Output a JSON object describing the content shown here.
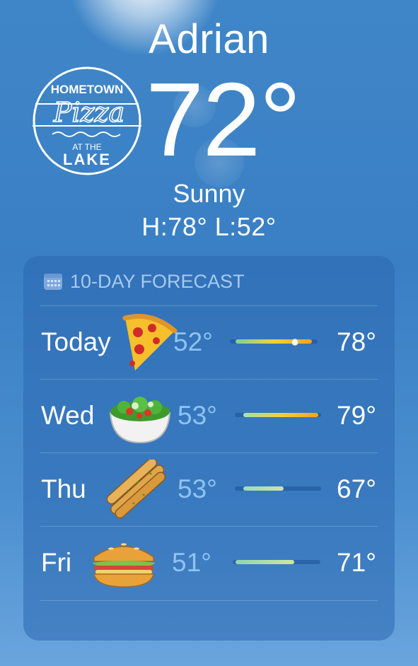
{
  "location": {
    "city": "Adrian",
    "temperature": "72°",
    "condition": "Sunny",
    "high_low": "H:78°  L:52°"
  },
  "logo": {
    "line1": "HOMETOWN",
    "line2": "Pizza",
    "line3": "AT THE",
    "line4": "LAKE"
  },
  "forecast": {
    "header": "10-DAY FORECAST",
    "range_min": 50,
    "range_max": 80,
    "days": [
      {
        "day": "Today",
        "icon": "pizza-slice-icon",
        "low": "52°",
        "high": "78°",
        "low_value": 52,
        "high_value": 78,
        "current_value": 72,
        "colors": [
          "#7ed0a0",
          "#f0d23a",
          "#f7a21b"
        ]
      },
      {
        "day": "Wed",
        "icon": "salad-bowl-icon",
        "low": "53°",
        "high": "79°",
        "low_value": 53,
        "high_value": 79,
        "colors": [
          "#a6e0b5",
          "#f2cf3a",
          "#f7a21b"
        ]
      },
      {
        "day": "Thu",
        "icon": "breadsticks-icon",
        "low": "53°",
        "high": "67°",
        "low_value": 53,
        "high_value": 67,
        "colors": [
          "#9ddcb8",
          "#c8e6a8"
        ]
      },
      {
        "day": "Fri",
        "icon": "sub-sandwich-icon",
        "low": "51°",
        "high": "71°",
        "low_value": 51,
        "high_value": 71,
        "colors": [
          "#8fd6b0",
          "#cfe6a0"
        ]
      }
    ]
  }
}
